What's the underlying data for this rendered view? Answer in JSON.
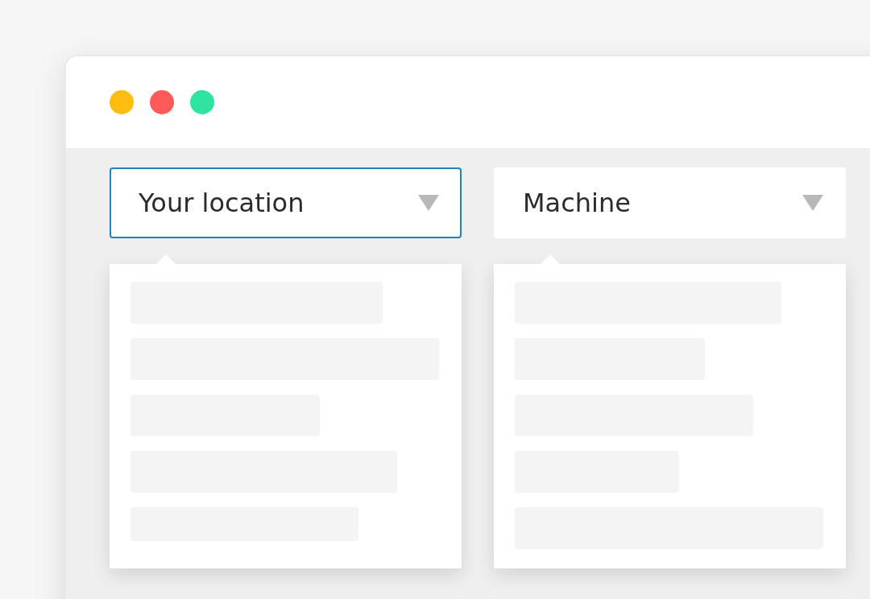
{
  "dropdowns": [
    {
      "value": "Your location",
      "selected": true
    },
    {
      "value": "Machine",
      "selected": false
    }
  ]
}
